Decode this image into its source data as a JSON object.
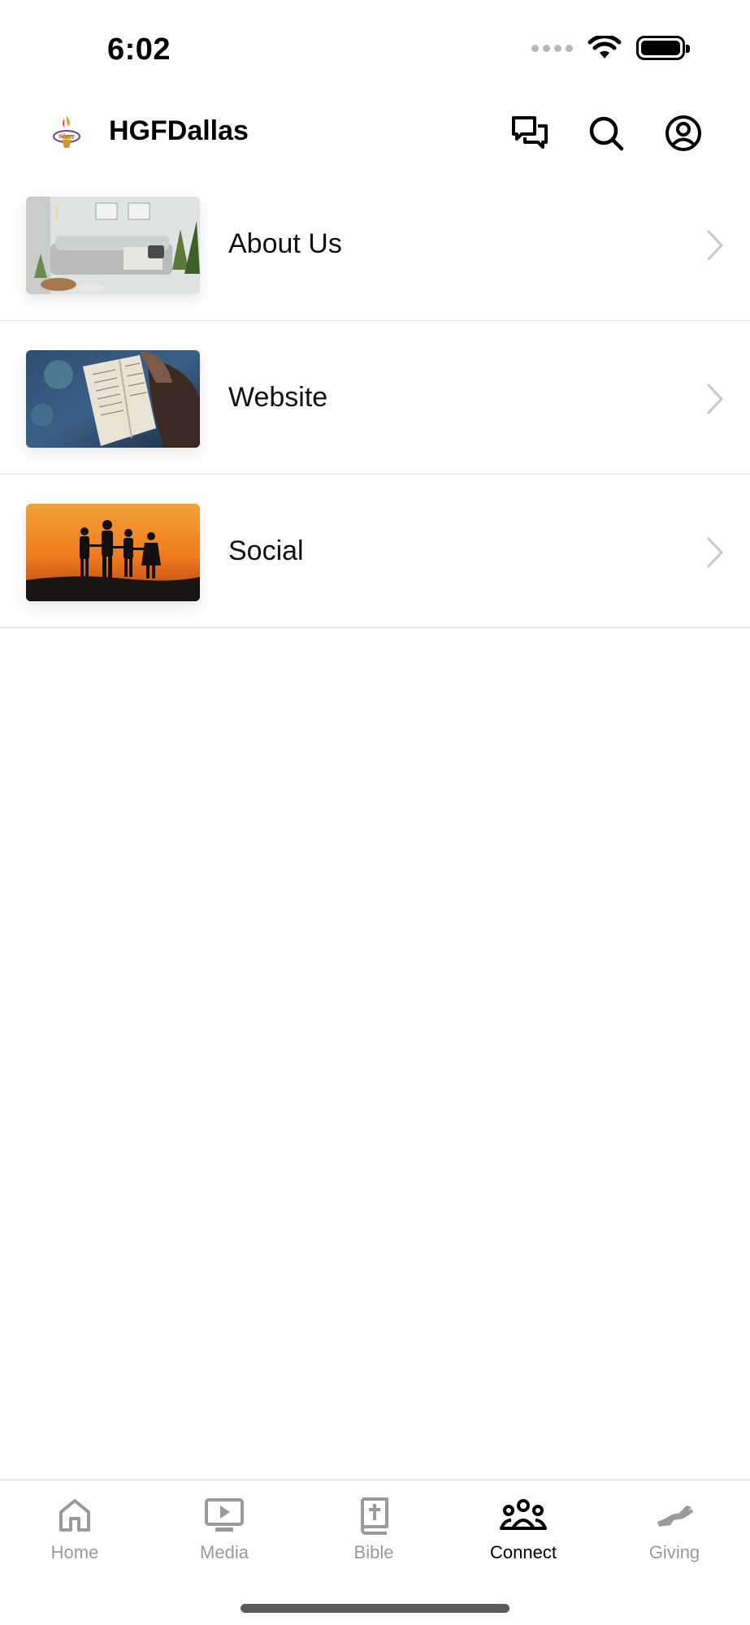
{
  "status_bar": {
    "time": "6:02"
  },
  "header": {
    "title": "HGFDallas"
  },
  "menu": {
    "items": [
      {
        "label": "About Us"
      },
      {
        "label": "Website"
      },
      {
        "label": "Social"
      }
    ]
  },
  "tab_bar": {
    "tabs": [
      {
        "label": "Home",
        "icon": "home-icon",
        "active": false
      },
      {
        "label": "Media",
        "icon": "media-icon",
        "active": false
      },
      {
        "label": "Bible",
        "icon": "bible-icon",
        "active": false
      },
      {
        "label": "Connect",
        "icon": "connect-icon",
        "active": true
      },
      {
        "label": "Giving",
        "icon": "giving-icon",
        "active": false
      }
    ]
  },
  "colors": {
    "active_tab": "#000000",
    "inactive_tab": "#9a9a9a",
    "divider": "#e4e4e4",
    "chevron": "#c7c7cc"
  }
}
